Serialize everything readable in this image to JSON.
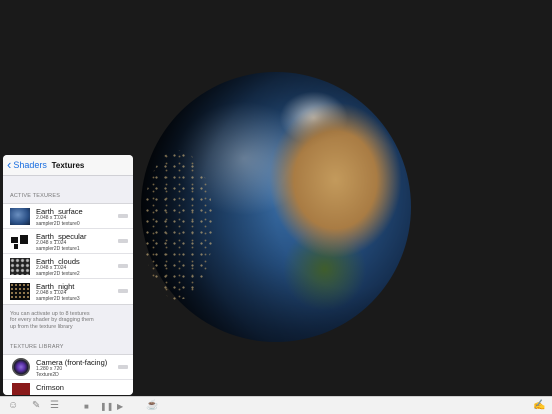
{
  "panel": {
    "back_label": "Shaders",
    "title": "Textures",
    "active_section_label": "ACTIVE TEXURES",
    "active_textures": [
      {
        "name": "Earth_surface",
        "size": "2.048 x 1.024",
        "binding": "sampler2D texture0"
      },
      {
        "name": "Earth_specular",
        "size": "2.048 x 1.024",
        "binding": "sampler2D texture1"
      },
      {
        "name": "Earth_clouds",
        "size": "2.048 x 1.024",
        "binding": "sampler2D texture2"
      },
      {
        "name": "Earth_night",
        "size": "2.048 x 1.024",
        "binding": "sampler2D texture3"
      }
    ],
    "help_lines": [
      "You can activate up to 8 textures",
      "for every shader by dragging them",
      "up from the texture library"
    ],
    "library_section_label": "TEXTURE LIBRARY",
    "library_items": [
      {
        "name": "Camera (front-facing)",
        "size": "1.280 x 720",
        "binding": "Texture2D"
      },
      {
        "name": "Crimson"
      }
    ]
  },
  "toolbar": {
    "icons": [
      "masks-icon",
      "pencil-icon",
      "sliders-icon",
      "stop-icon",
      "pause-icon",
      "play-icon",
      "teapot-icon",
      "edit-icon"
    ]
  }
}
